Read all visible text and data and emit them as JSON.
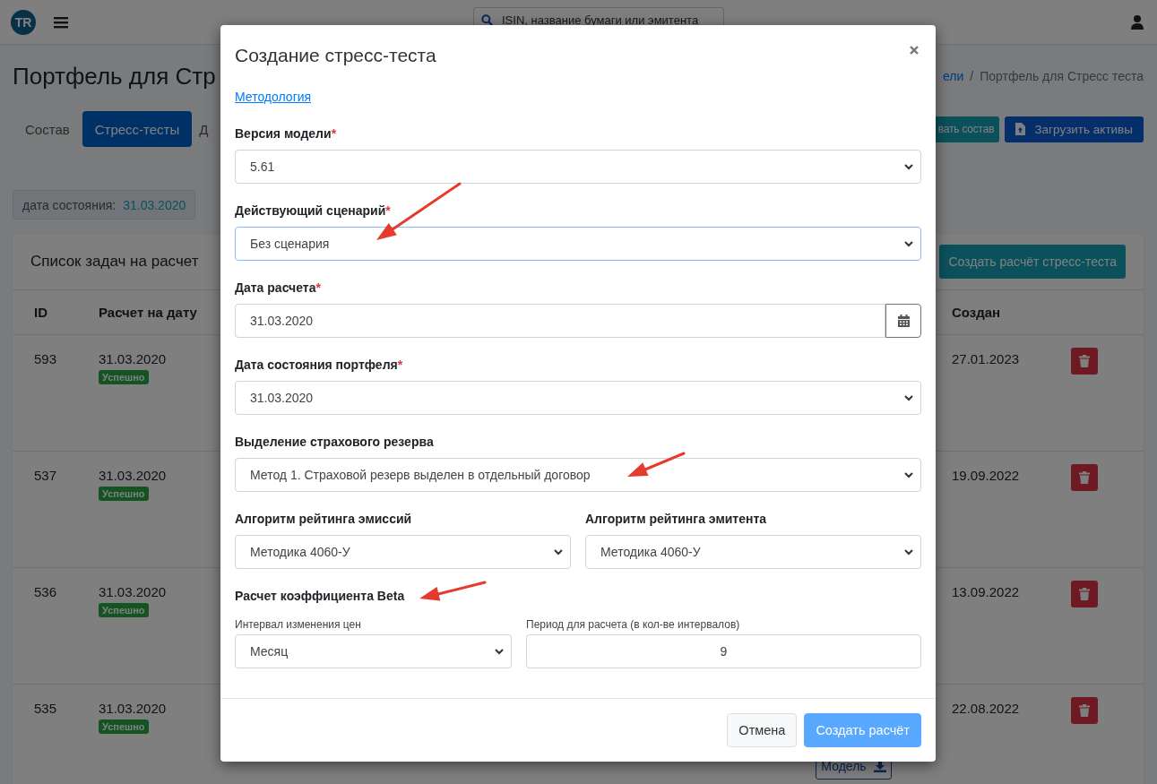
{
  "navbar": {
    "logo": "TR",
    "search": {
      "placeholder": "ISIN, название бумаги или эмитента"
    }
  },
  "page": {
    "title": "Портфель для Стр",
    "breadcrumb": [
      "ели",
      "Портфель для Стресс теста"
    ],
    "breadcrumb_separator": "/",
    "tabs": [
      {
        "label": "Состав",
        "selected": false
      },
      {
        "label": "Стресс-тесты",
        "selected": true
      },
      {
        "label": "Д",
        "selected": false
      }
    ],
    "actions": [
      {
        "label": "вать состав",
        "kind": "teal"
      },
      {
        "label": "Загрузить активы",
        "kind": "upload"
      }
    ],
    "state_date": {
      "label": "дата состояния:",
      "value": "31.03.2020"
    }
  },
  "tasks": {
    "title": "Список задач на расчет",
    "create_button": "Создать расчёт стресс-теста",
    "columns": [
      "ID",
      "Расчет на дату",
      "Создан"
    ],
    "rows": [
      {
        "id": "593",
        "date": "31.03.2020",
        "status": "Успешно",
        "created": "27.01.2023"
      },
      {
        "id": "537",
        "date": "31.03.2020",
        "status": "Успешно",
        "created": "19.09.2022"
      },
      {
        "id": "536",
        "date": "31.03.2020",
        "status": "Успешно",
        "created": "13.09.2022"
      },
      {
        "id": "535",
        "date": "31.03.2020",
        "status": "Успешно",
        "created": "22.08.2022",
        "model_button": "Модель"
      }
    ]
  },
  "modal": {
    "title": "Создание стресс-теста",
    "link": "Методология",
    "fields": [
      {
        "label": "Версия модели",
        "required_mark": "*",
        "kind": "select",
        "value": "5.61",
        "focused": false
      },
      {
        "label": "Действующий сценарий",
        "required_mark": "*",
        "kind": "select",
        "value": "Без сценария",
        "focused": true
      },
      {
        "label": "Дата расчета",
        "required_mark": "*",
        "kind": "date",
        "value": "31.03.2020",
        "focused": false
      },
      {
        "label": "Дата состояния портфеля",
        "required_mark": "*",
        "kind": "select",
        "value": "31.03.2020",
        "focused": false
      },
      {
        "label": "Выделение страхового резерва",
        "kind": "select",
        "value": "Метод 1. Страховой резерв выделен в отдельный договор",
        "focused": false
      }
    ],
    "pair": [
      {
        "label": "Алгоритм рейтинга эмиссий",
        "value": "Методика 4060-У"
      },
      {
        "label": "Алгоритм рейтинга эмитента",
        "value": "Методика 4060-У"
      }
    ],
    "beta": {
      "title": "Расчет коэффициента Beta",
      "interval": {
        "label": "Интервал изменения цен",
        "value": "Месяц"
      },
      "period": {
        "label": "Период для расчета (в кол-ве интервалов)",
        "value": "9"
      }
    },
    "buttons": [
      {
        "label": "Отмена",
        "kind": "secondary",
        "disabled": false
      },
      {
        "label": "Создать расчёт",
        "kind": "primary",
        "disabled": true
      }
    ]
  }
}
